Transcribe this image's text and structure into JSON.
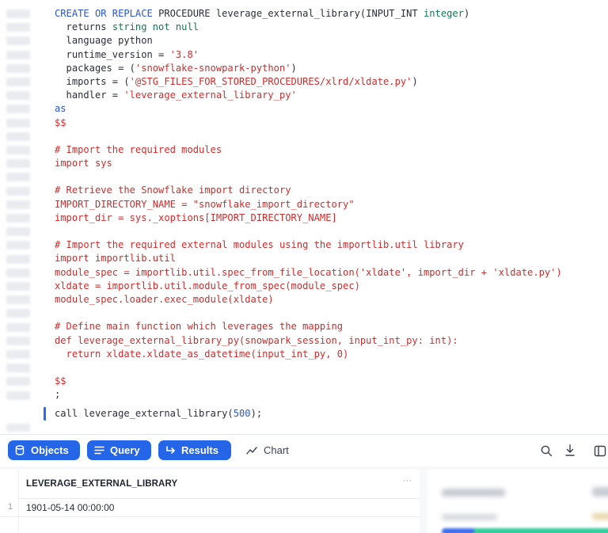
{
  "editor": {
    "lines": [
      [
        {
          "t": "CREATE OR REPLACE ",
          "c": "blue"
        },
        {
          "t": "PROCEDURE",
          "c": "dark"
        },
        {
          "t": " leverage_external_library(",
          "c": "dark"
        },
        {
          "t": "INPUT_INT",
          "c": "dark"
        },
        {
          "t": " ",
          "c": "dark"
        },
        {
          "t": "integer",
          "c": "green"
        },
        {
          "t": ")",
          "c": "dark"
        }
      ],
      [
        {
          "t": "  returns ",
          "c": "dark"
        },
        {
          "t": "string not null",
          "c": "green"
        }
      ],
      [
        {
          "t": "  language python",
          "c": "dark"
        }
      ],
      [
        {
          "t": "  runtime_version = ",
          "c": "dark"
        },
        {
          "t": "'3.8'",
          "c": "red"
        }
      ],
      [
        {
          "t": "  packages = (",
          "c": "dark"
        },
        {
          "t": "'snowflake-snowpark-python'",
          "c": "red"
        },
        {
          "t": ")",
          "c": "dark"
        }
      ],
      [
        {
          "t": "  imports = (",
          "c": "dark"
        },
        {
          "t": "'@STG_FILES_FOR_STORED_PROCEDURES/xlrd/xldate.py'",
          "c": "red"
        },
        {
          "t": ")",
          "c": "dark"
        }
      ],
      [
        {
          "t": "  handler = ",
          "c": "dark"
        },
        {
          "t": "'leverage_external_library_py'",
          "c": "red"
        }
      ],
      [
        {
          "t": "as",
          "c": "blue"
        }
      ],
      [
        {
          "t": "$$",
          "c": "red"
        }
      ],
      [
        {
          "t": "",
          "c": "red"
        }
      ],
      [
        {
          "t": "# Import the required modules",
          "c": "red"
        }
      ],
      [
        {
          "t": "import sys",
          "c": "red"
        }
      ],
      [
        {
          "t": "",
          "c": "red"
        }
      ],
      [
        {
          "t": "# Retrieve the Snowflake import directory",
          "c": "red"
        }
      ],
      [
        {
          "t": "IMPORT_DIRECTORY_NAME = \"snowflake_import_directory\"",
          "c": "red"
        }
      ],
      [
        {
          "t": "import_dir = sys._xoptions[IMPORT_DIRECTORY_NAME]",
          "c": "red"
        }
      ],
      [
        {
          "t": "",
          "c": "red"
        }
      ],
      [
        {
          "t": "# Import the required external modules using the importlib.util library",
          "c": "red"
        }
      ],
      [
        {
          "t": "import importlib.util",
          "c": "red"
        }
      ],
      [
        {
          "t": "module_spec = importlib.util.spec_from_file_location('xldate', import_dir + 'xldate.py')",
          "c": "red"
        }
      ],
      [
        {
          "t": "xldate = importlib.util.module_from_spec(module_spec)",
          "c": "red"
        }
      ],
      [
        {
          "t": "module_spec.loader.exec_module(xldate)",
          "c": "red"
        }
      ],
      [
        {
          "t": "",
          "c": "red"
        }
      ],
      [
        {
          "t": "# Define main function which leverages the mapping",
          "c": "red"
        }
      ],
      [
        {
          "t": "def leverage_external_library_py(snowpark_session, input_int_py: int):",
          "c": "red"
        }
      ],
      [
        {
          "t": "  return xldate.xldate_as_datetime(input_int_py, 0)",
          "c": "red"
        }
      ],
      [
        {
          "t": "",
          "c": "red"
        }
      ],
      [
        {
          "t": "$$",
          "c": "red"
        }
      ],
      [
        {
          "t": ";",
          "c": "dark"
        }
      ]
    ],
    "call_prefix": "call leverage_external_library(",
    "call_arg": "500",
    "call_suffix": ");"
  },
  "toolbar": {
    "objects_label": "Objects",
    "query_label": "Query",
    "results_label": "Results",
    "chart_label": "Chart",
    "icons": [
      "database-icon",
      "lines-icon",
      "return-arrow-icon",
      "trend-line-icon",
      "search-icon",
      "download-icon",
      "split-panel-icon"
    ]
  },
  "results": {
    "columns": [
      "LEVERAGE_EXTERNAL_LIBRARY"
    ],
    "more_label": "···",
    "rows": [
      {
        "num": "1",
        "value": "1901-05-14 00:00:00"
      }
    ]
  },
  "colors": {
    "accent": "#2566e8",
    "keyword": "#2a57d5",
    "string": "#d12c2c",
    "type": "#117a52"
  }
}
